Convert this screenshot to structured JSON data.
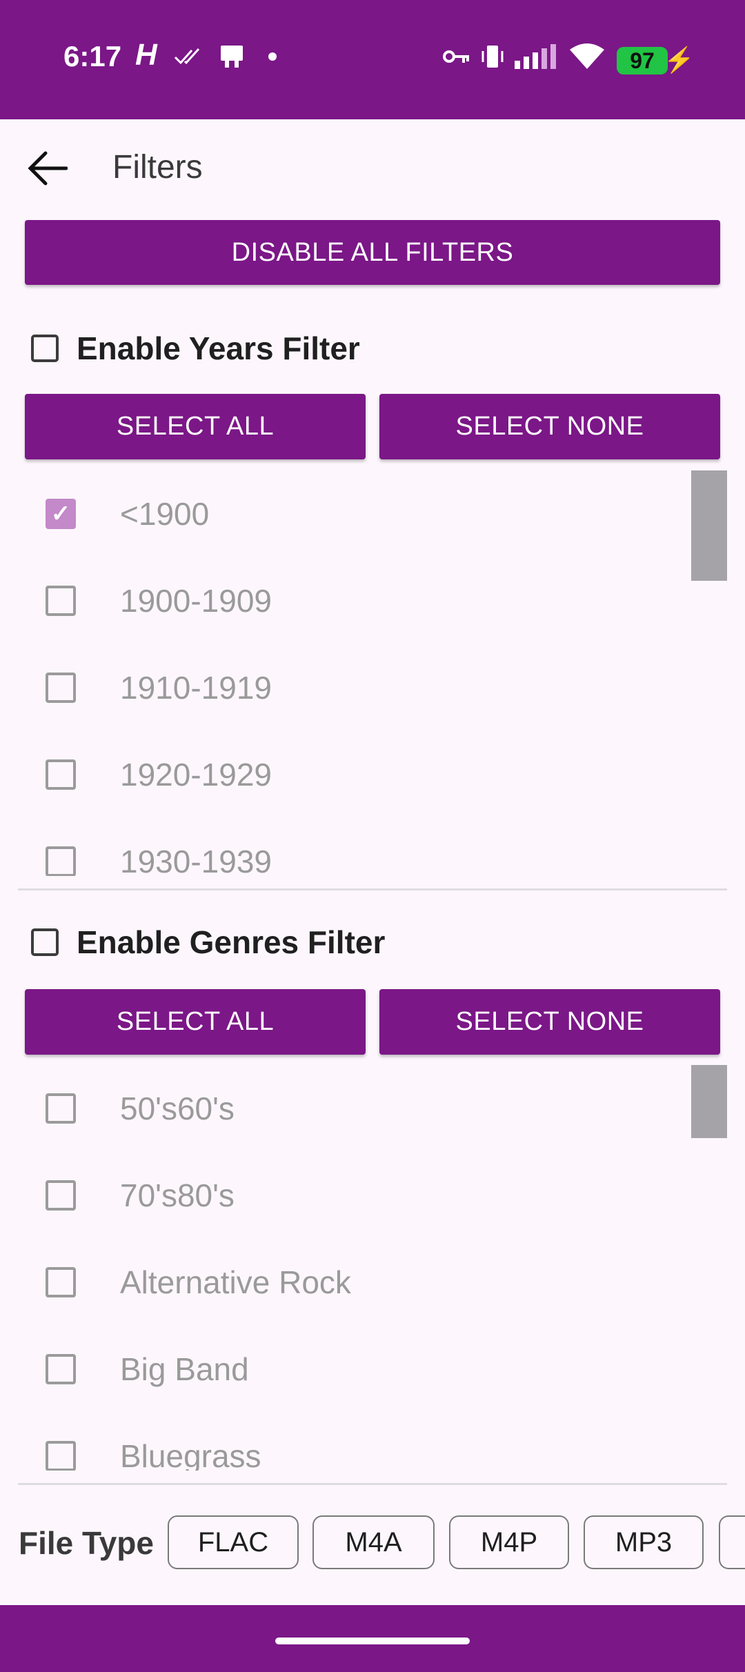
{
  "status_bar": {
    "time": "6:17",
    "battery_level": "97",
    "icons": [
      "notification-h-icon",
      "double-check-icon",
      "cast-icon",
      "dot-icon",
      "vpn-key-icon",
      "vibrate-icon",
      "signal-icon",
      "wifi-icon",
      "battery-icon",
      "charging-bolt-icon"
    ]
  },
  "app_bar": {
    "title": "Filters",
    "back_icon": "arrow-back-icon"
  },
  "disable_all_label": "DISABLE ALL FILTERS",
  "years": {
    "enable_label": "Enable Years Filter",
    "enabled": false,
    "select_all_label": "SELECT ALL",
    "select_none_label": "SELECT NONE",
    "items": [
      {
        "label": "<1900",
        "checked": true
      },
      {
        "label": "1900-1909",
        "checked": false
      },
      {
        "label": "1910-1919",
        "checked": false
      },
      {
        "label": "1920-1929",
        "checked": false
      },
      {
        "label": "1930-1939",
        "checked": false
      }
    ]
  },
  "genres": {
    "enable_label": "Enable Genres Filter",
    "enabled": false,
    "select_all_label": "SELECT ALL",
    "select_none_label": "SELECT NONE",
    "items": [
      {
        "label": "50's60's",
        "checked": false
      },
      {
        "label": "70's80's",
        "checked": false
      },
      {
        "label": "Alternative Rock",
        "checked": false
      },
      {
        "label": "Big Band",
        "checked": false
      },
      {
        "label": "Bluegrass",
        "checked": false
      }
    ]
  },
  "file_type": {
    "label": "File Type",
    "chips": [
      "FLAC",
      "M4A",
      "M4P",
      "MP3",
      ""
    ]
  },
  "colors": {
    "accent": "#7b1787",
    "checked_box": "#c389c9",
    "background": "#fdf7fd"
  }
}
